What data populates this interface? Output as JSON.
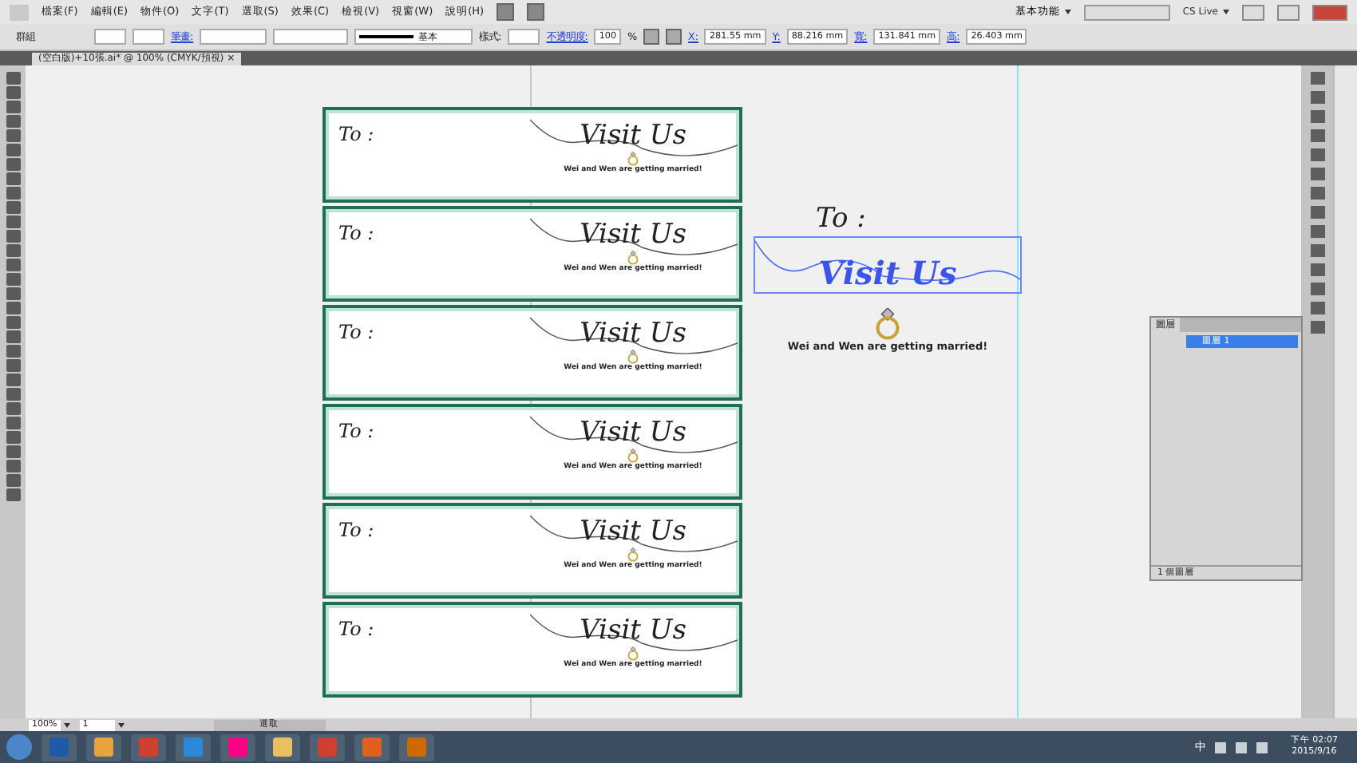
{
  "menu": [
    "檔案(F)",
    "編輯(E)",
    "物件(O)",
    "文字(T)",
    "選取(S)",
    "效果(C)",
    "檢視(V)",
    "視窗(W)",
    "說明(H)"
  ],
  "workspace": "基本功能",
  "control_bar": {
    "selection": "群組",
    "stroke_label": "筆畫:",
    "stroke_profile": "基本",
    "style_label": "樣式:",
    "opacity_label": "不透明度:",
    "opacity": "100",
    "percent": "%",
    "fields": [
      {
        "label": "X:",
        "value": "281.55 mm"
      },
      {
        "label": "Y:",
        "value": "88.216 mm"
      },
      {
        "label": "寬:",
        "value": "131.841 mm"
      },
      {
        "label": "高:",
        "value": "26.403 mm"
      }
    ]
  },
  "cs_live": "CS Live",
  "document_tab": "(空白版)+10張.ai* @ 100% (CMYK/預視)",
  "document_tab_close": "×",
  "cards": [
    {
      "to": "To :",
      "title": "Visit Us",
      "caption": "Wei and Wen are getting married!"
    },
    {
      "to": "To :",
      "title": "Visit Us",
      "caption": "Wei and Wen are getting married!"
    },
    {
      "to": "To :",
      "title": "Visit Us",
      "caption": "Wei and Wen are getting married!"
    },
    {
      "to": "To :",
      "title": "Visit Us",
      "caption": "Wei and Wen are getting married!"
    },
    {
      "to": "To :",
      "title": "Visit Us",
      "caption": "Wei and Wen are getting married!"
    },
    {
      "to": "To :",
      "title": "Visit Us",
      "caption": "Wei and Wen are getting married!"
    }
  ],
  "loose_design": {
    "to": "To :",
    "title": "Visit Us",
    "title_selected": true,
    "caption": "Wei and Wen are getting married!"
  },
  "layers_panel": {
    "title": "圖層",
    "layers": [
      {
        "name": "圖層 1",
        "selected": true
      }
    ],
    "footer": "1 個圖層"
  },
  "status_bar": {
    "zoom": "100%",
    "page": "1",
    "status": "選取"
  },
  "taskbar": {
    "tray_ime": "中",
    "time": "下午 02:07",
    "date": "2015/9/16"
  }
}
